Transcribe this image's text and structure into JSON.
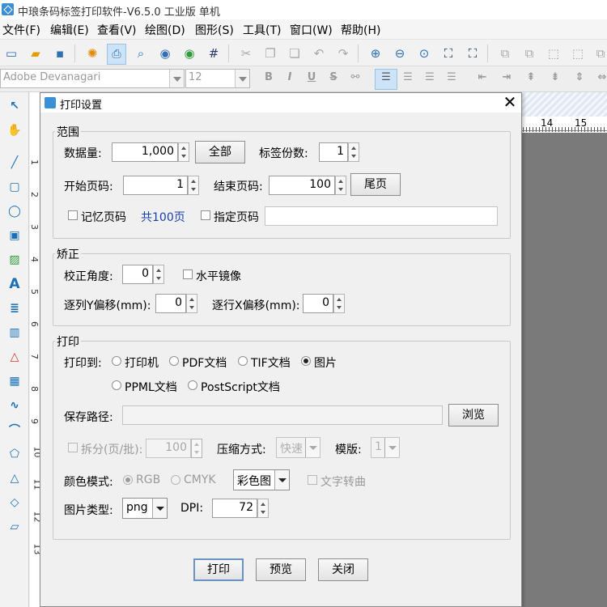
{
  "app": {
    "title": "中琅条码标签打印软件-V6.5.0 工业版 单机"
  },
  "menu": [
    "文件(F)",
    "编辑(E)",
    "查看(V)",
    "绘图(D)",
    "图形(S)",
    "工具(T)",
    "窗口(W)",
    "帮助(H)"
  ],
  "formatbar": {
    "font": "Adobe Devanagari",
    "size": "12",
    "bold": "B",
    "italic": "I",
    "underline": "U",
    "strike": "S"
  },
  "ruler": {
    "h": [
      "14",
      "15"
    ],
    "v": [
      "1",
      "2",
      "3",
      "4",
      "5",
      "6",
      "7",
      "8",
      "9",
      "10",
      "11",
      "12",
      "13"
    ]
  },
  "dialog": {
    "title": "打印设置",
    "range": {
      "title": "范围",
      "quantity_label": "数据量:",
      "quantity_value": "1,000",
      "all_button": "全部",
      "copies_label": "标签份数:",
      "copies_value": "1",
      "start_label": "开始页码:",
      "start_value": "1",
      "end_label": "结束页码:",
      "end_value": "100",
      "last_button": "尾页",
      "remember_label": "记忆页码",
      "total_label": "共100页",
      "specify_label": "指定页码",
      "specify_value": ""
    },
    "correction": {
      "title": "矫正",
      "angle_label": "校正角度:",
      "angle_value": "0",
      "mirror_label": "水平镜像",
      "col_offset_label": "逐列Y偏移(mm):",
      "col_offset_value": "0",
      "row_offset_label": "逐行X偏移(mm):",
      "row_offset_value": "0"
    },
    "print": {
      "title": "打印",
      "target_label": "打印到:",
      "options": [
        "打印机",
        "PDF文档",
        "TIF文档",
        "图片",
        "PPML文档",
        "PostScript文档"
      ],
      "selected": "图片",
      "save_path_label": "保存路径:",
      "save_path_value": "",
      "browse_button": "浏览",
      "split_label": "拆分(页/批):",
      "split_value": "100",
      "compress_label": "压缩方式:",
      "compress_value": "快速",
      "template_label": "模版:",
      "template_value": "1",
      "color_mode_label": "颜色模式:",
      "color_rgb": "RGB",
      "color_cmyk": "CMYK",
      "color_select": "彩色图",
      "text_curve_label": "文字转曲",
      "image_type_label": "图片类型:",
      "image_type_value": "png",
      "dpi_label": "DPI:",
      "dpi_value": "72"
    },
    "buttons": {
      "print": "打印",
      "preview": "预览",
      "close": "关闭"
    }
  }
}
